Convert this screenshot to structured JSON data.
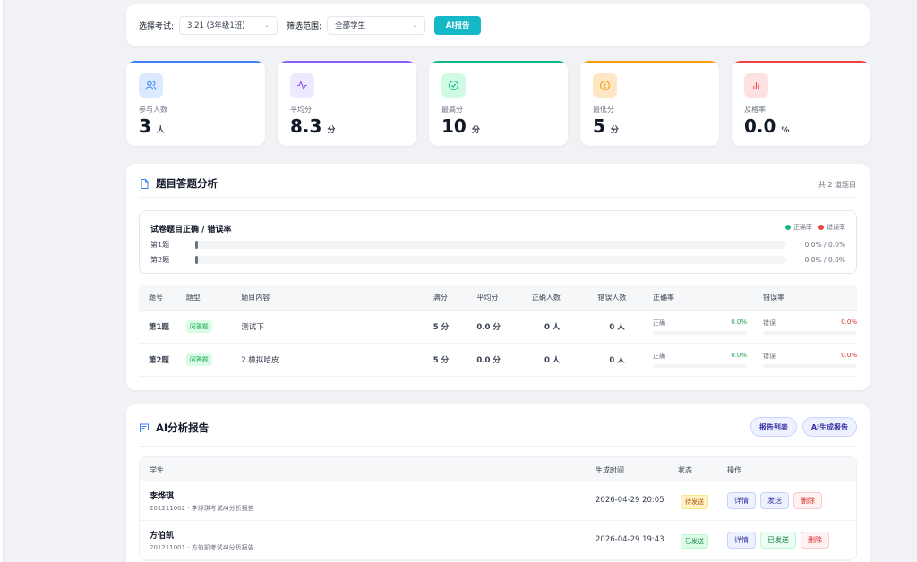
{
  "filter": {
    "exam_label": "选择考试:",
    "exam_value": "3.21 (3年级1班)",
    "range_label": "筛选范围:",
    "range_value": "全部学生",
    "ai_button": "AI报告"
  },
  "stats": [
    {
      "label": "参与人数",
      "value": "3",
      "unit": "人",
      "color": "#3b82f6",
      "bg": "#dbeafe",
      "icon": "users-icon"
    },
    {
      "label": "平均分",
      "value": "8.3",
      "unit": "分",
      "color": "#8b5cf6",
      "bg": "#ede9fe",
      "icon": "activity-icon"
    },
    {
      "label": "最高分",
      "value": "10",
      "unit": "分",
      "color": "#10b981",
      "bg": "#d1fae5",
      "icon": "check-circle-icon"
    },
    {
      "label": "最低分",
      "value": "5",
      "unit": "分",
      "color": "#f59e0b",
      "bg": "#fde7c4",
      "icon": "info-circle-icon"
    },
    {
      "label": "及格率",
      "value": "0.0",
      "unit": "%",
      "color": "#ef4444",
      "bg": "#fee2e2",
      "icon": "bar-chart-icon"
    }
  ],
  "analysis": {
    "title": "题目答题分析",
    "total": "共 2 道题目",
    "chart_title": "试卷题目正确 / 错误率",
    "legend_correct": "正确率",
    "legend_wrong": "错误率",
    "bars": [
      {
        "name": "第1题",
        "pct": "0.0% / 0.0%"
      },
      {
        "name": "第2题",
        "pct": "0.0% / 0.0%"
      }
    ],
    "columns": [
      "题号",
      "题型",
      "题目内容",
      "满分",
      "平均分",
      "正确人数",
      "错误人数",
      "正确率",
      "错误率"
    ],
    "rows": [
      {
        "no": "第1题",
        "type": "问答题",
        "content": "测试下",
        "full": "5 分",
        "avg": "0.0 分",
        "right": "0 人",
        "wrong": "0 人",
        "right_label": "正确",
        "right_rate": "0.0%",
        "wrong_label": "错误",
        "wrong_rate": "0.0%"
      },
      {
        "no": "第2题",
        "type": "问答题",
        "content": "2.橡拟哈皮",
        "full": "5 分",
        "avg": "0.0 分",
        "right": "0 人",
        "wrong": "0 人",
        "right_label": "正确",
        "right_rate": "0.0%",
        "wrong_label": "错误",
        "wrong_rate": "0.0%"
      }
    ]
  },
  "ai": {
    "title": "AI分析报告",
    "btn_list": "报告列表",
    "btn_gen": "AI生成报告",
    "columns": {
      "student": "学生",
      "time": "生成时间",
      "status": "状态",
      "action": "操作"
    },
    "rows": [
      {
        "name": "李烨琪",
        "sub": "201211002 · 李烨琪考试AI分析报告",
        "time": "2026-04-29 20:05",
        "status": "待发送",
        "status_type": "pending",
        "detail": "详情",
        "send": "发送",
        "delete": "删除"
      },
      {
        "name": "方伯凯",
        "sub": "201211001 · 方伯凯考试AI分析报告",
        "time": "2026-04-29 19:43",
        "status": "已发送",
        "status_type": "sent",
        "detail": "详情",
        "send": "已发送",
        "delete": "删除"
      }
    ]
  }
}
